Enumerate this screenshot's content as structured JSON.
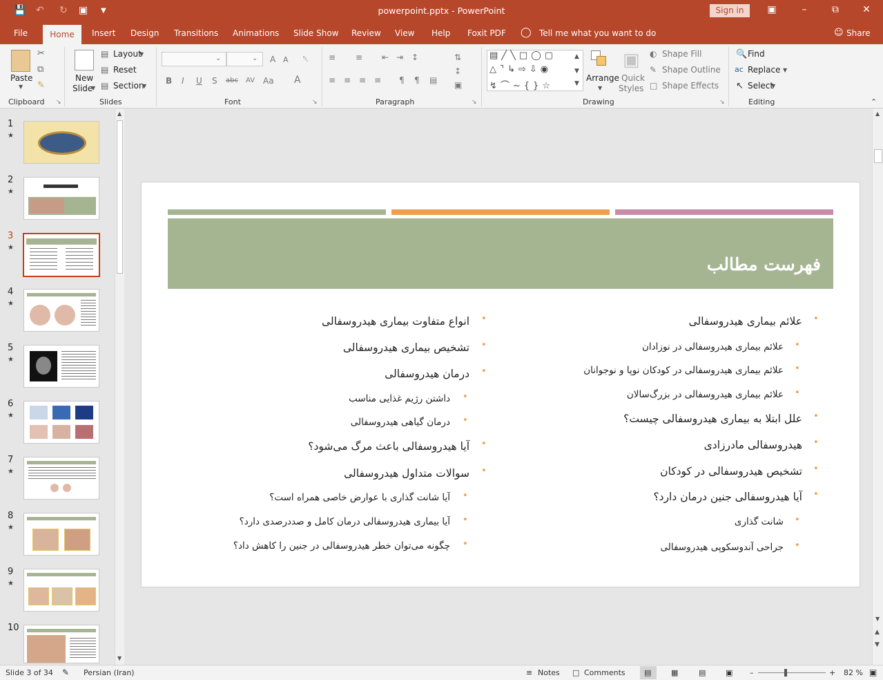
{
  "app": {
    "doc_title": "powerpoint.pptx - PowerPoint",
    "sign_in": "Sign in"
  },
  "tabs": [
    "File",
    "Home",
    "Insert",
    "Design",
    "Transitions",
    "Animations",
    "Slide Show",
    "Review",
    "View",
    "Help",
    "Foxit PDF"
  ],
  "active_tab": "Home",
  "tell_me": "Tell me what you want to do",
  "share": "Share",
  "ribbon": {
    "paste": "Paste",
    "new_slide_1": "New",
    "new_slide_2": "Slide",
    "layout": "Layout",
    "reset": "Reset",
    "section": "Section",
    "arrange": "Arrange",
    "quick_styles_1": "Quick",
    "quick_styles_2": "Styles",
    "shape_fill": "Shape Fill",
    "shape_outline": "Shape Outline",
    "shape_effects": "Shape Effects",
    "find": "Find",
    "replace": "Replace",
    "select": "Select",
    "groups": {
      "clipboard": "Clipboard",
      "slides": "Slides",
      "font": "Font",
      "paragraph": "Paragraph",
      "drawing": "Drawing",
      "editing": "Editing"
    }
  },
  "thumbnails": [
    "1",
    "2",
    "3",
    "4",
    "5",
    "6",
    "7",
    "8",
    "9",
    "10"
  ],
  "selected_thumb": "3",
  "slide": {
    "title": "فهرست مطالب",
    "right_col": [
      {
        "text": "علائم بیماری هیدروسفالی",
        "level": 1
      },
      {
        "text": "علائم بیماری هیدروسفالی در نوزادان",
        "level": 2
      },
      {
        "text": "علائم بیماری هیدروسفالی در کودکان نوپا و نوجوانان",
        "level": 2
      },
      {
        "text": "علائم بیماری هیدروسفالی در بزرگ‌سالان",
        "level": 2
      },
      {
        "text": "علل ابتلا به بیماری هیدروسفالی چیست؟",
        "level": 1
      },
      {
        "text": "هیدروسفالی مادرزادی",
        "level": 1
      },
      {
        "text": "تشخیص هیدروسفالی در کودکان",
        "level": 1
      },
      {
        "text": "آیا هیدروسفالی جنین درمان دارد؟",
        "level": 1
      },
      {
        "text": "شانت گذاری",
        "level": 2
      },
      {
        "text": "جراحی آندوسکوپی هیدروسفالی",
        "level": 2
      }
    ],
    "left_col": [
      {
        "text": "انواع متفاوت بیماری هیدروسفالی",
        "level": 1
      },
      {
        "text": "تشخیص بیماری هیدروسفالی",
        "level": 1
      },
      {
        "text": "درمان هیدروسفالی",
        "level": 1
      },
      {
        "text": "داشتن رژیم غذایی مناسب",
        "level": 2
      },
      {
        "text": "درمان گیاهی هیدروسفالی",
        "level": 2
      },
      {
        "text": "آیا هیدروسفالی باعث مرگ می‌شود؟",
        "level": 1
      },
      {
        "text": "سوالات متداول هیدروسفالی",
        "level": 1
      },
      {
        "text": "آیا شانت گذاری با عوارض خاصی همراه است؟",
        "level": 2
      },
      {
        "text": "آیا بیماری هیدروسفالی درمان کامل و صددرصدی دارد؟",
        "level": 2
      },
      {
        "text": "چگونه می‌توان خطر هیدروسفالی در جنین را کاهش داد؟",
        "level": 2
      }
    ]
  },
  "status": {
    "slide_info": "Slide 3 of 34",
    "language": "Persian (Iran)",
    "notes": "Notes",
    "comments": "Comments",
    "zoom": "82 %"
  },
  "colors": {
    "accent": "#b7472a",
    "banner": "#a5b592",
    "bar_orange": "#ef9f4b",
    "bar_pink": "#c98aa8",
    "bullet": "#ef9f4b"
  }
}
